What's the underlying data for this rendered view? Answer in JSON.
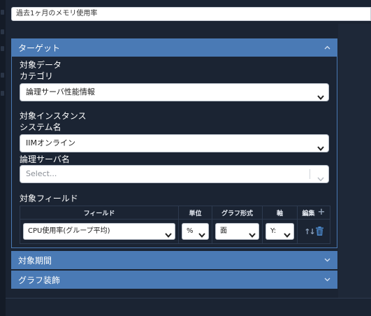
{
  "form": {
    "title_value": "過去1ヶ月のメモリ使用率"
  },
  "target_panel": {
    "header": "ターゲット",
    "target_data_label": "対象データ",
    "category_label": "カテゴリ",
    "category_value": "論理サーバ性能情報",
    "target_instance_label": "対象インスタンス",
    "system_name_label": "システム名",
    "system_name_value": "IIMオンライン",
    "logical_server_label": "論理サーバ名",
    "logical_server_placeholder": "Select...",
    "target_field_label": "対象フィールド",
    "table": {
      "headers": {
        "field": "フィールド",
        "unit": "単位",
        "graph_type": "グラフ形式",
        "axis": "軸",
        "edit": "編集"
      },
      "rows": [
        {
          "field": "CPU使用率(グループ平均)",
          "unit": "%",
          "graph_type": "面",
          "axis": "Y:"
        }
      ]
    }
  },
  "period_panel": {
    "header": "対象期間"
  },
  "decoration_panel": {
    "header": "グラフ装飾"
  },
  "colors": {
    "panel_header": "#4a7ab5",
    "background": "#1b2433",
    "trash_icon": "#4a86c8"
  },
  "icons": [
    "chevron-up-icon",
    "chevron-down-icon",
    "plus-icon",
    "sort-icon",
    "trash-icon"
  ]
}
